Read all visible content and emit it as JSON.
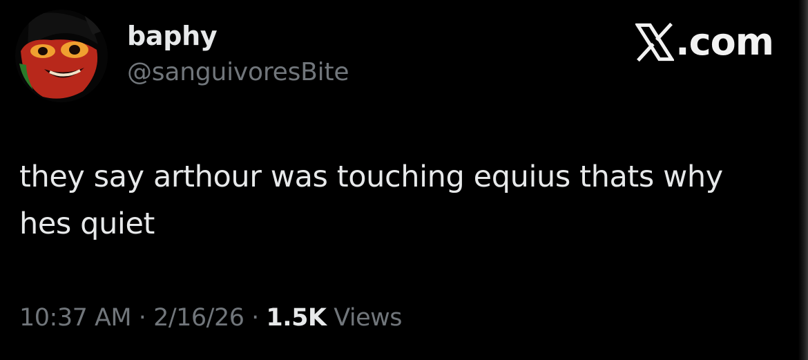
{
  "author": {
    "display_name": "baphy",
    "handle": "@sanguivoresBite",
    "avatar": "cartoon-face-avatar"
  },
  "brand": {
    "icon": "x-logo-icon",
    "label": ".com"
  },
  "tweet": {
    "text": "they say arthour was touching equius thats why hes quiet"
  },
  "meta": {
    "time": "10:37 AM",
    "separator": "·",
    "date": "2/16/26",
    "views_count": "1.5K",
    "views_label": "Views"
  },
  "colors": {
    "background": "#000000",
    "primary_text": "#e7e9ea",
    "secondary_text": "#71767b"
  }
}
